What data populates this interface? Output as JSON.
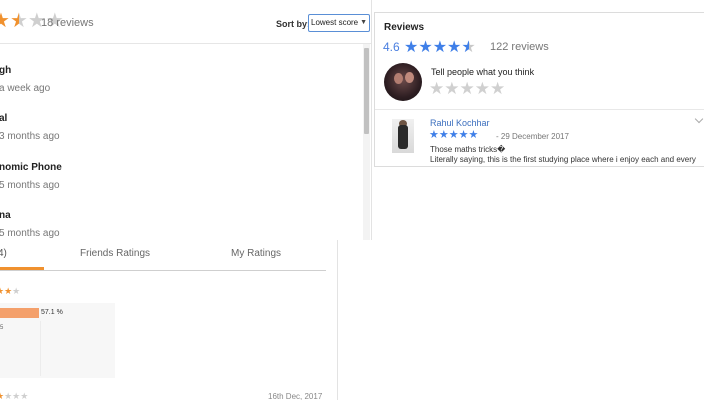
{
  "review_list": {
    "rating_value": 2.5,
    "reviews_count": "18 reviews",
    "sort_label": "Sort by:",
    "sort_selected": "Lowest score",
    "reviews": [
      {
        "name": "gh",
        "date": "a week ago"
      },
      {
        "name": "al",
        "date": "3 months ago"
      },
      {
        "name": "nomic Phone",
        "date": "5 months ago"
      },
      {
        "name": "na",
        "date": "5 months ago"
      }
    ]
  },
  "google_reviews": {
    "title": "Reviews",
    "rating": "4.6",
    "rating_value": 4.6,
    "count": "122 reviews",
    "prompt": "Tell people what you think",
    "review": {
      "author": "Rahul Kochhar",
      "stars": 5,
      "date": "29 December 2017",
      "line1": "Those maths tricks�",
      "line2": "Literally saying, this is the first studying place where i enjoy each and every"
    }
  },
  "ratings_panel": {
    "tabs": [
      "4)",
      "Friends Ratings",
      "My Ratings"
    ],
    "active_tab": 0,
    "bar_percent": 57.1,
    "bar_label": "57.1 %",
    "small_label": "5",
    "date": "16th Dec, 2017"
  },
  "colors": {
    "orange": "#f0912e",
    "blue": "#3f7fe8",
    "bar": "#f4a06b"
  }
}
